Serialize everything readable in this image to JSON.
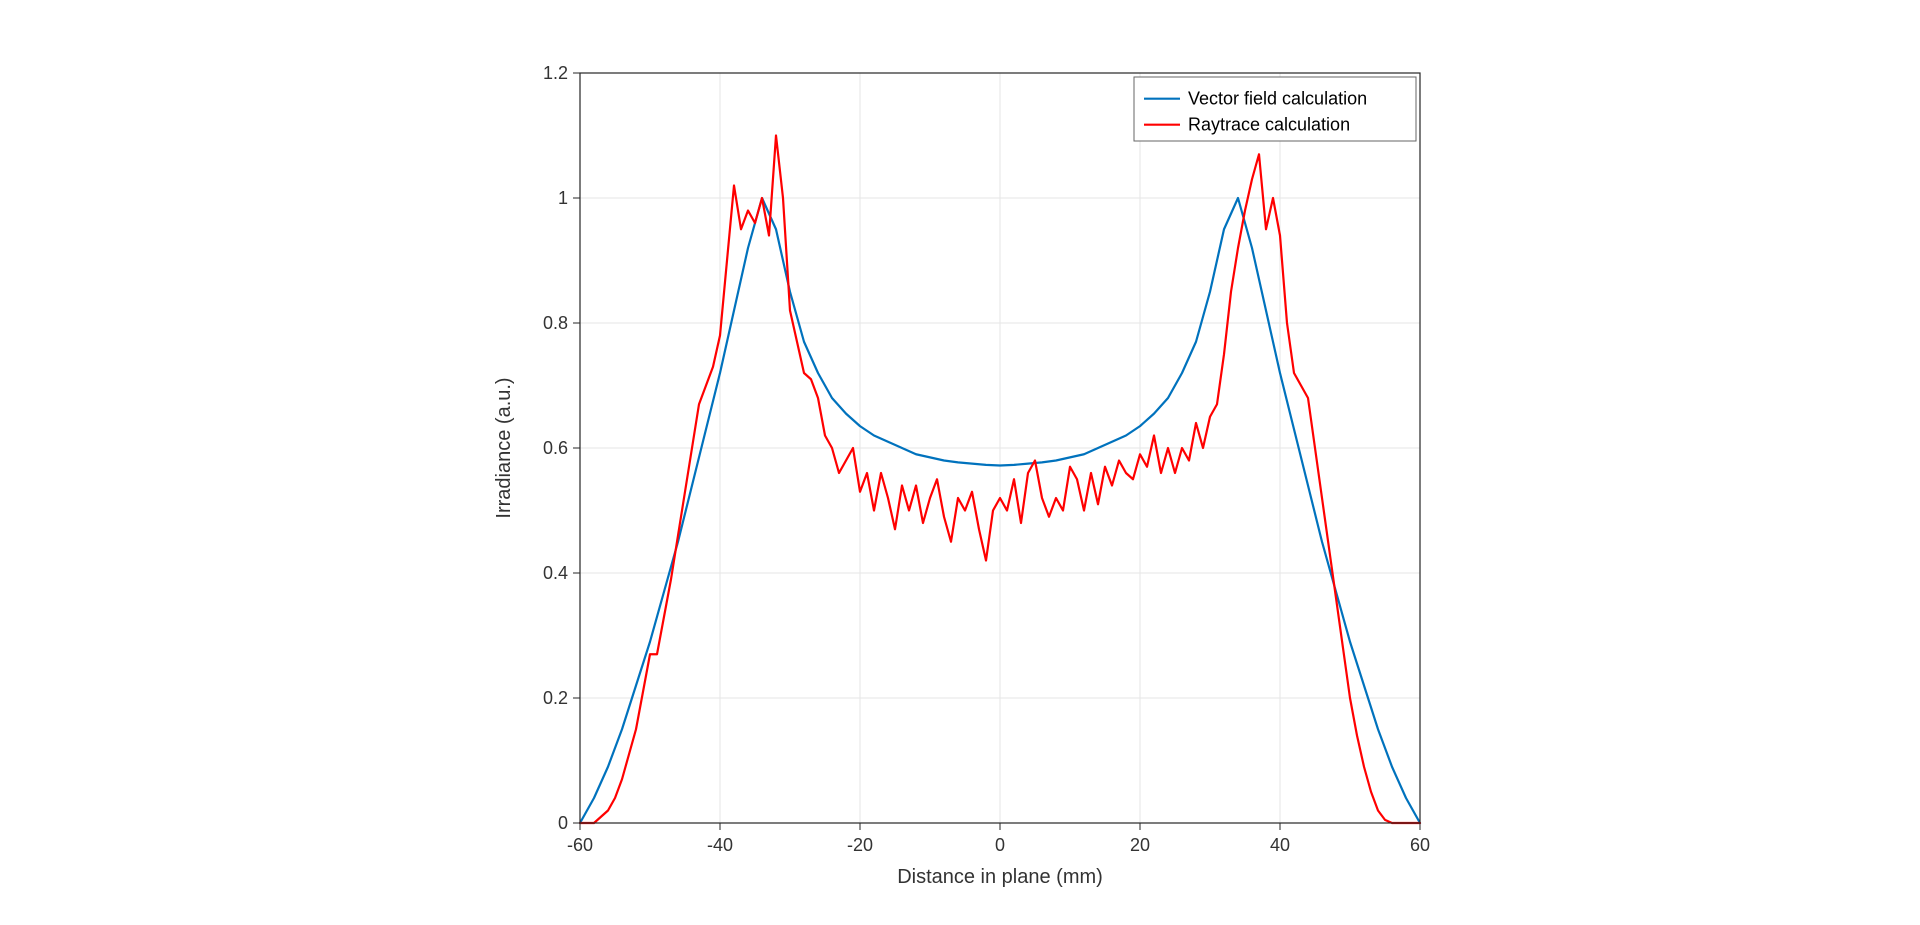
{
  "chart_data": {
    "type": "line",
    "xlabel": "Distance in plane (mm)",
    "ylabel": "Irradiance (a.u.)",
    "xlim": [
      -60,
      60
    ],
    "ylim": [
      0,
      1.2
    ],
    "xticks": [
      -60,
      -40,
      -20,
      0,
      20,
      40,
      60
    ],
    "yticks": [
      0,
      0.2,
      0.4,
      0.6,
      0.8,
      1,
      1.2
    ],
    "legend_position": "top-right",
    "grid": true,
    "series": [
      {
        "name": "Vector field calculation",
        "color": "#0072BD",
        "x": [
          -60,
          -58,
          -56,
          -54,
          -52,
          -50,
          -48,
          -46,
          -44,
          -42,
          -40,
          -38,
          -36,
          -34,
          -32,
          -30,
          -28,
          -26,
          -24,
          -22,
          -20,
          -18,
          -16,
          -14,
          -12,
          -10,
          -8,
          -6,
          -4,
          -2,
          0,
          2,
          4,
          6,
          8,
          10,
          12,
          14,
          16,
          18,
          20,
          22,
          24,
          26,
          28,
          30,
          32,
          34,
          36,
          38,
          40,
          42,
          44,
          46,
          48,
          50,
          52,
          54,
          56,
          58,
          60
        ],
        "y": [
          0.0,
          0.04,
          0.09,
          0.15,
          0.22,
          0.29,
          0.37,
          0.45,
          0.54,
          0.63,
          0.72,
          0.82,
          0.92,
          1.0,
          0.95,
          0.85,
          0.77,
          0.72,
          0.68,
          0.655,
          0.635,
          0.62,
          0.61,
          0.6,
          0.59,
          0.585,
          0.58,
          0.577,
          0.575,
          0.573,
          0.572,
          0.573,
          0.575,
          0.577,
          0.58,
          0.585,
          0.59,
          0.6,
          0.61,
          0.62,
          0.635,
          0.655,
          0.68,
          0.72,
          0.77,
          0.85,
          0.95,
          1.0,
          0.92,
          0.82,
          0.72,
          0.63,
          0.54,
          0.45,
          0.37,
          0.29,
          0.22,
          0.15,
          0.09,
          0.04,
          0.0
        ]
      },
      {
        "name": "Raytrace calculation",
        "color": "#FF0000",
        "x": [
          -60,
          -58,
          -57,
          -56,
          -55,
          -54,
          -53,
          -52,
          -51,
          -50,
          -49,
          -48,
          -47,
          -46,
          -45,
          -44,
          -43,
          -42,
          -41,
          -40,
          -39,
          -38,
          -37,
          -36,
          -35,
          -34,
          -33,
          -32,
          -31,
          -30,
          -29,
          -28,
          -27,
          -26,
          -25,
          -24,
          -23,
          -22,
          -21,
          -20,
          -19,
          -18,
          -17,
          -16,
          -15,
          -14,
          -13,
          -12,
          -11,
          -10,
          -9,
          -8,
          -7,
          -6,
          -5,
          -4,
          -3,
          -2,
          -1,
          0,
          1,
          2,
          3,
          4,
          5,
          6,
          7,
          8,
          9,
          10,
          11,
          12,
          13,
          14,
          15,
          16,
          17,
          18,
          19,
          20,
          21,
          22,
          23,
          24,
          25,
          26,
          27,
          28,
          29,
          30,
          31,
          32,
          33,
          34,
          35,
          36,
          37,
          38,
          39,
          40,
          41,
          42,
          43,
          44,
          45,
          46,
          47,
          48,
          49,
          50,
          51,
          52,
          53,
          54,
          55,
          56,
          57,
          58,
          60
        ],
        "y": [
          0.0,
          0.0,
          0.01,
          0.02,
          0.04,
          0.07,
          0.11,
          0.15,
          0.21,
          0.27,
          0.27,
          0.33,
          0.39,
          0.46,
          0.53,
          0.6,
          0.67,
          0.7,
          0.73,
          0.78,
          0.9,
          1.02,
          0.95,
          0.98,
          0.96,
          1.0,
          0.94,
          1.1,
          1.0,
          0.82,
          0.77,
          0.72,
          0.71,
          0.68,
          0.62,
          0.6,
          0.56,
          0.58,
          0.6,
          0.53,
          0.56,
          0.5,
          0.56,
          0.52,
          0.47,
          0.54,
          0.5,
          0.54,
          0.48,
          0.52,
          0.55,
          0.49,
          0.45,
          0.52,
          0.5,
          0.53,
          0.47,
          0.42,
          0.5,
          0.52,
          0.5,
          0.55,
          0.48,
          0.56,
          0.58,
          0.52,
          0.49,
          0.52,
          0.5,
          0.57,
          0.55,
          0.5,
          0.56,
          0.51,
          0.57,
          0.54,
          0.58,
          0.56,
          0.55,
          0.59,
          0.57,
          0.62,
          0.56,
          0.6,
          0.56,
          0.6,
          0.58,
          0.64,
          0.6,
          0.65,
          0.67,
          0.75,
          0.85,
          0.92,
          0.98,
          1.03,
          1.07,
          0.95,
          1.0,
          0.94,
          0.8,
          0.72,
          0.7,
          0.68,
          0.6,
          0.52,
          0.44,
          0.36,
          0.28,
          0.2,
          0.14,
          0.09,
          0.05,
          0.02,
          0.005,
          0.0,
          0.0,
          0.0,
          0.0
        ]
      }
    ]
  }
}
